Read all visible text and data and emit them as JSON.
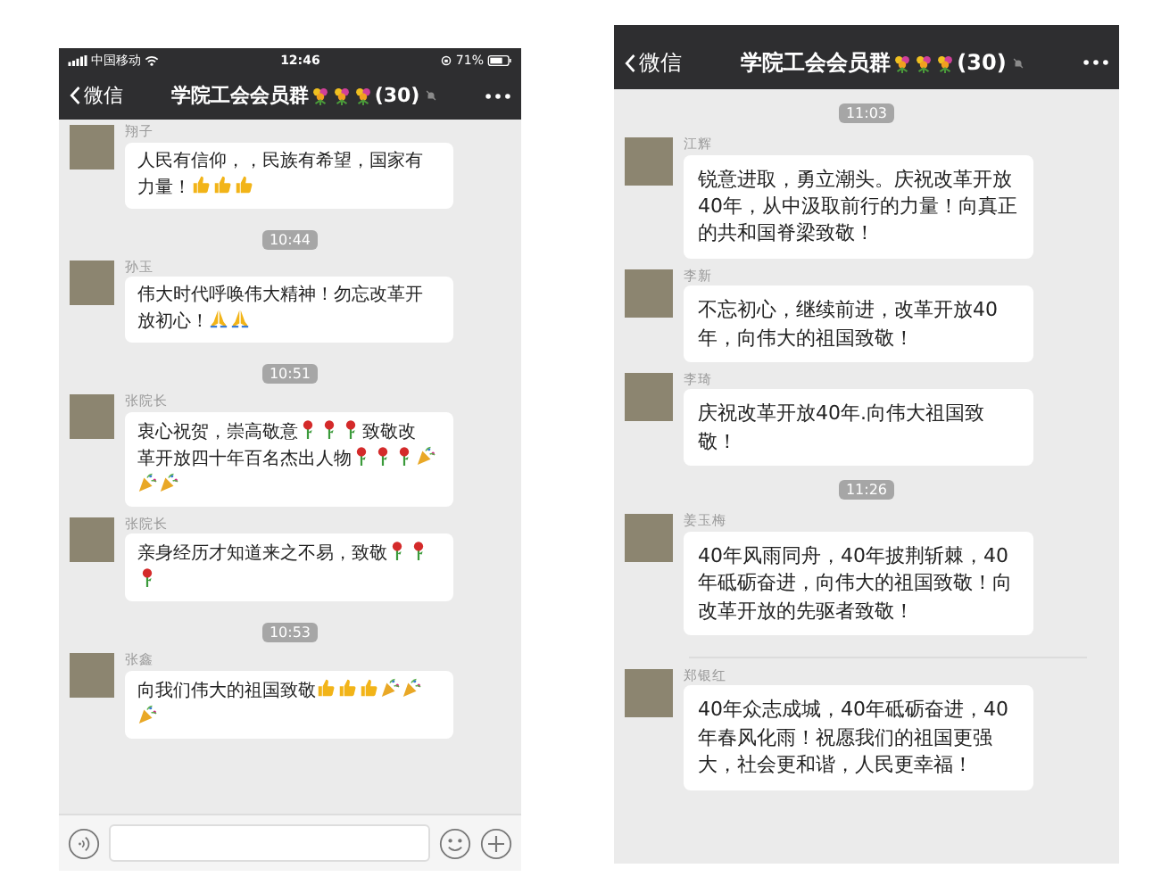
{
  "phones": [
    {
      "status_bar": {
        "carrier": "中国移动",
        "time": "12:46",
        "battery": "71%"
      },
      "nav": {
        "back": "微信",
        "title_parts": [
          {
            "kind": "text",
            "text": "学院工会会员群"
          },
          {
            "kind": "flower"
          },
          {
            "kind": "flower"
          },
          {
            "kind": "flower"
          },
          {
            "kind": "text",
            "text": "(30)"
          }
        ],
        "muted": true
      },
      "items": [
        {
          "kind": "message",
          "sender": "翔子",
          "parts": [
            {
              "kind": "text",
              "text": "人民有信仰，，民族有希望，国家有"
            },
            {
              "kind": "text",
              "text": "力量！"
            },
            {
              "kind": "thumbs"
            },
            {
              "kind": "thumbs"
            },
            {
              "kind": "thumbs"
            }
          ]
        },
        {
          "kind": "time",
          "text": "10:44"
        },
        {
          "kind": "message",
          "sender": "孙玉",
          "parts": [
            {
              "kind": "text",
              "text": "伟大时代呼唤伟大精神！勿忘改革开"
            },
            {
              "kind": "text",
              "text": "放初心！"
            },
            {
              "kind": "pray"
            },
            {
              "kind": "pray"
            }
          ]
        },
        {
          "kind": "time",
          "text": "10:51"
        },
        {
          "kind": "message",
          "sender": "张院长",
          "parts": [
            {
              "kind": "text",
              "text": "衷心祝贺，崇高敬意"
            },
            {
              "kind": "rose"
            },
            {
              "kind": "rose"
            },
            {
              "kind": "rose"
            },
            {
              "kind": "text",
              "text": "致敬改"
            },
            {
              "kind": "text",
              "text": "革开放四十年百名杰出人物"
            },
            {
              "kind": "rose"
            },
            {
              "kind": "rose"
            },
            {
              "kind": "rose"
            },
            {
              "kind": "party"
            },
            {
              "kind": "party"
            },
            {
              "kind": "party"
            }
          ]
        },
        {
          "kind": "message",
          "sender": "张院长",
          "parts": [
            {
              "kind": "text",
              "text": "亲身经历才知道来之不易，致敬"
            },
            {
              "kind": "rose"
            },
            {
              "kind": "rose"
            },
            {
              "kind": "rose"
            }
          ]
        },
        {
          "kind": "time",
          "text": "10:53"
        },
        {
          "kind": "message",
          "sender": "张鑫",
          "parts": [
            {
              "kind": "text",
              "text": "向我们伟大的祖国致敬"
            },
            {
              "kind": "thumbs"
            },
            {
              "kind": "thumbs"
            },
            {
              "kind": "thumbs"
            },
            {
              "kind": "party"
            },
            {
              "kind": "party"
            },
            {
              "kind": "party"
            }
          ]
        }
      ],
      "input_bar": true
    },
    {
      "nav": {
        "back": "微信",
        "title_parts": [
          {
            "kind": "text",
            "text": "学院工会会员群"
          },
          {
            "kind": "flower"
          },
          {
            "kind": "flower"
          },
          {
            "kind": "flower"
          },
          {
            "kind": "text",
            "text": "(30)"
          }
        ],
        "muted": true
      },
      "items": [
        {
          "kind": "time",
          "text": "11:03"
        },
        {
          "kind": "message",
          "sender": "江辉",
          "parts": [
            {
              "kind": "text",
              "text": "锐意进取，勇立潮头。庆祝改革开放40年，从中汲取前行的力量！向真正的共和国脊梁致敬！"
            }
          ]
        },
        {
          "kind": "message",
          "sender": "李新",
          "parts": [
            {
              "kind": "text",
              "text": "不忘初心，继续前进，改革开放40年，向伟大的祖国致敬！"
            }
          ]
        },
        {
          "kind": "message",
          "sender": "李琦",
          "parts": [
            {
              "kind": "text",
              "text": "庆祝改革开放40年.向伟大祖国致敬！"
            }
          ]
        },
        {
          "kind": "time",
          "text": "11:26"
        },
        {
          "kind": "message",
          "sender": "姜玉梅",
          "parts": [
            {
              "kind": "text",
              "text": "40年风雨同舟，40年披荆斩棘，40年砥砺奋进，向伟大的祖国致敬！向改革开放的先驱者致敬！"
            }
          ]
        },
        {
          "kind": "divider"
        },
        {
          "kind": "message",
          "sender": "郑银红",
          "parts": [
            {
              "kind": "text",
              "text": "40年众志成城，40年砥砺奋进，40年春风化雨！祝愿我们的祖国更强大，社会更和谐，人民更幸福！"
            }
          ]
        }
      ],
      "input_bar": false
    }
  ]
}
